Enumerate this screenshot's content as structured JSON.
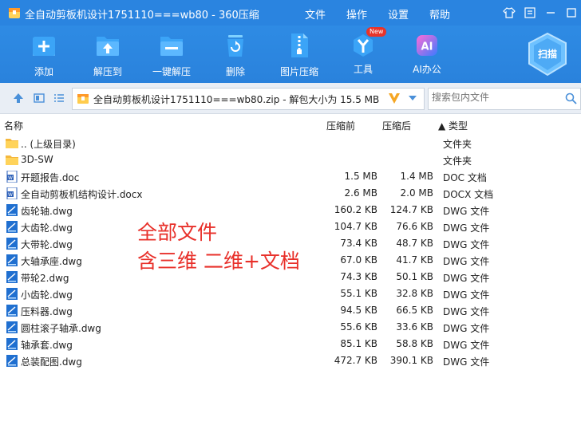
{
  "window": {
    "title": "全自动剪板机设计1751110===wb80 - 360压缩"
  },
  "menu": [
    "文件",
    "操作",
    "设置",
    "帮助"
  ],
  "toolbar": {
    "buttons": [
      {
        "label": "添加",
        "icon": "add-icon"
      },
      {
        "label": "解压到",
        "icon": "extract-to-icon"
      },
      {
        "label": "一键解压",
        "icon": "one-click-extract-icon"
      },
      {
        "label": "删除",
        "icon": "trash-icon"
      },
      {
        "label": "图片压缩",
        "icon": "image-compress-icon"
      },
      {
        "label": "工具",
        "icon": "tools-icon",
        "badge": "New"
      },
      {
        "label": "AI办公",
        "icon": "ai-office-icon",
        "icon_text": "AI"
      }
    ],
    "scan_label": "扫描"
  },
  "address": {
    "path": "全自动剪板机设计1751110===wb80.zip - 解包大小为 15.5 MB"
  },
  "search": {
    "placeholder": "搜索包内文件"
  },
  "columns": {
    "name": "名称",
    "compressed": "压缩前",
    "uncompressed": "压缩后",
    "type": "▲ 类型"
  },
  "files": [
    {
      "name": ".. (上级目录)",
      "before": "",
      "after": "",
      "type": "文件夹",
      "kind": "folder"
    },
    {
      "name": "3D-SW",
      "before": "",
      "after": "",
      "type": "文件夹",
      "kind": "folder"
    },
    {
      "name": "开题报告.doc",
      "before": "1.5 MB",
      "after": "1.4 MB",
      "type": "DOC 文档",
      "kind": "doc"
    },
    {
      "name": "全自动剪板机结构设计.docx",
      "before": "2.6 MB",
      "after": "2.0 MB",
      "type": "DOCX 文档",
      "kind": "doc"
    },
    {
      "name": "齿轮轴.dwg",
      "before": "160.2 KB",
      "after": "124.7 KB",
      "type": "DWG 文件",
      "kind": "dwg"
    },
    {
      "name": "大齿轮.dwg",
      "before": "104.7 KB",
      "after": "76.6 KB",
      "type": "DWG 文件",
      "kind": "dwg"
    },
    {
      "name": "大带轮.dwg",
      "before": "73.4 KB",
      "after": "48.7 KB",
      "type": "DWG 文件",
      "kind": "dwg"
    },
    {
      "name": "大轴承座.dwg",
      "before": "67.0 KB",
      "after": "41.7 KB",
      "type": "DWG 文件",
      "kind": "dwg"
    },
    {
      "name": "带轮2.dwg",
      "before": "74.3 KB",
      "after": "50.1 KB",
      "type": "DWG 文件",
      "kind": "dwg"
    },
    {
      "name": "小齿轮.dwg",
      "before": "55.1 KB",
      "after": "32.8 KB",
      "type": "DWG 文件",
      "kind": "dwg"
    },
    {
      "name": "压料器.dwg",
      "before": "94.5 KB",
      "after": "66.5 KB",
      "type": "DWG 文件",
      "kind": "dwg"
    },
    {
      "name": "圆柱滚子轴承.dwg",
      "before": "55.6 KB",
      "after": "33.6 KB",
      "type": "DWG 文件",
      "kind": "dwg"
    },
    {
      "name": "轴承套.dwg",
      "before": "85.1 KB",
      "after": "58.8 KB",
      "type": "DWG 文件",
      "kind": "dwg"
    },
    {
      "name": "总装配图.dwg",
      "before": "472.7 KB",
      "after": "390.1 KB",
      "type": "DWG 文件",
      "kind": "dwg"
    }
  ],
  "overlay": {
    "line1": "全部文件",
    "line2": "含三维 二维+文档"
  }
}
